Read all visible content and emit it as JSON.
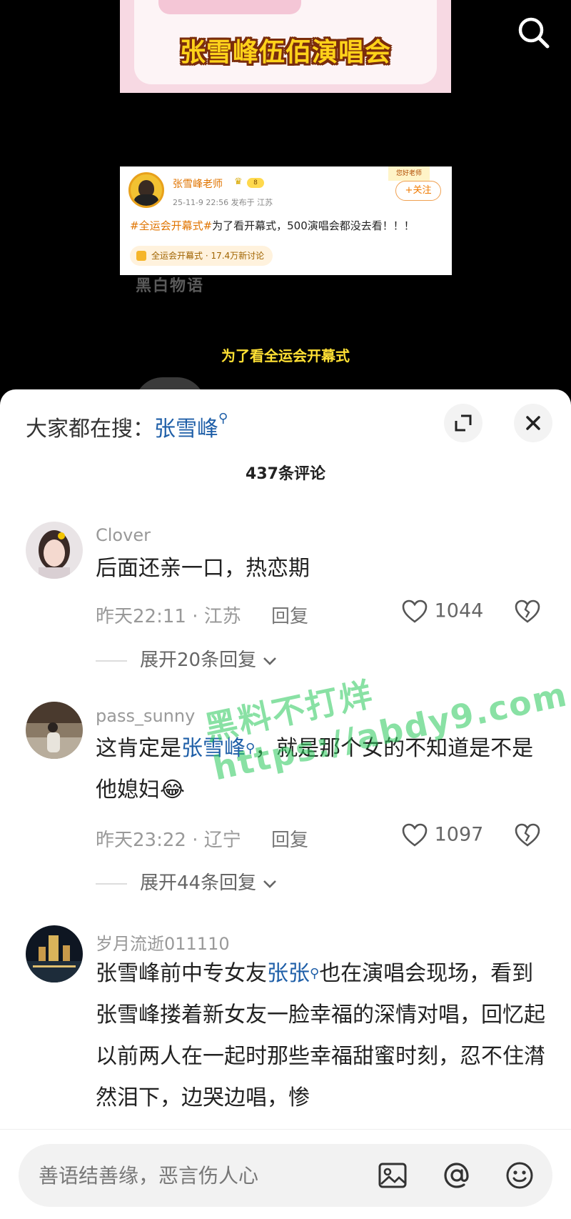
{
  "video": {
    "banner_title": "张雪峰伍佰演唱会",
    "post": {
      "author": "张雪峰老师",
      "level": "8",
      "meta": "25-11-9 22:56  发布于 江苏",
      "sticker": "您好老师",
      "follow_label": "+关注",
      "hashtag": "#全运会开幕式#",
      "text": "为了看开幕式，500演唱会都没去看！！！",
      "topic": "全运会开幕式 · 17.4万新讨论"
    },
    "watermark": "黑白物语",
    "subtitle": "为了看全运会开幕式"
  },
  "sheet": {
    "trending_prefix": "大家都在搜：",
    "trending_term": "张雪峰",
    "comment_count": "437条评论",
    "comments": [
      {
        "name": "Clover",
        "text": "后面还亲一口，热恋期",
        "meta": "昨天22:11 · 江苏",
        "reply": "回复",
        "likes": "1044",
        "expand": "展开20条回复"
      },
      {
        "name": "pass_sunny",
        "text_before": "这肯定是",
        "link": "张雪峰",
        "text_after": "，就是那个女的不知道是不是他媳妇😂",
        "meta": "昨天23:22 · 辽宁",
        "reply": "回复",
        "likes": "1097",
        "expand": "展开44条回复"
      },
      {
        "name": "岁月流逝011110",
        "text_before": "张雪峰前中专女友",
        "link": "张张",
        "text_after": "也在演唱会现场，看到张雪峰搂着新女友一脸幸福的深情对唱，回忆起以前两人在一起时那些幸福甜蜜时刻，忍不住潸然泪下，边哭边唱，惨"
      }
    ],
    "overlay_watermark": "黑料不打烊 https://abdy9.com"
  },
  "input": {
    "placeholder": "善语结善缘，恶言伤人心"
  },
  "icons": {
    "search": "search-icon",
    "expand": "expand-icon",
    "close": "close-icon",
    "heart": "heart-icon",
    "dislike": "broken-heart-icon",
    "chevron": "chevron-down-icon",
    "image": "image-icon",
    "at": "at-icon",
    "emoji": "emoji-icon"
  }
}
